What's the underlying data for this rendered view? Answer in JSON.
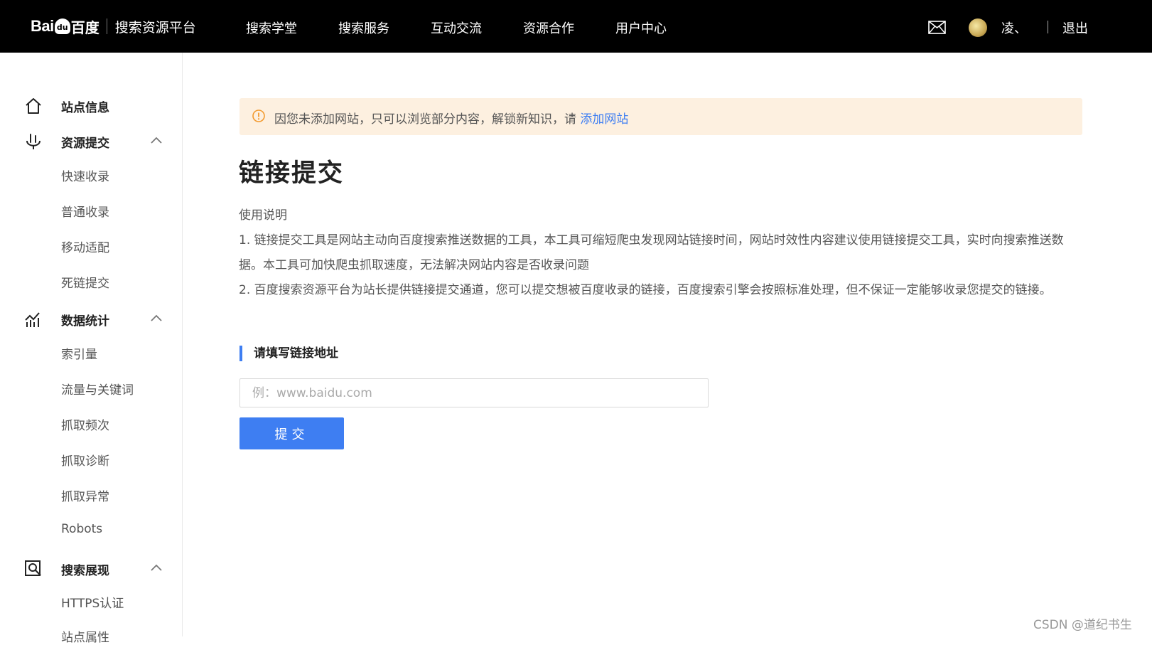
{
  "header": {
    "logo_brand": "Bai",
    "logo_du": "du",
    "logo_cn": "百度",
    "platform_name": "搜索资源平台",
    "nav": [
      "搜索学堂",
      "搜索服务",
      "互动交流",
      "资源合作",
      "用户中心"
    ],
    "username": "凌、",
    "logout_label": "退出"
  },
  "sidebar": {
    "groups": [
      {
        "label": "站点信息",
        "icon": "home-icon"
      },
      {
        "label": "资源提交",
        "icon": "submit-icon",
        "items": [
          "快速收录",
          "普通收录",
          "移动适配",
          "死链提交"
        ]
      },
      {
        "label": "数据统计",
        "icon": "chart-icon",
        "items": [
          "索引量",
          "流量与关键词",
          "抓取频次",
          "抓取诊断",
          "抓取异常",
          "Robots"
        ]
      },
      {
        "label": "搜索展现",
        "icon": "search-display-icon",
        "items": [
          "HTTPS认证",
          "站点属性"
        ]
      }
    ]
  },
  "notice": {
    "text": "因您未添加网站，只可以浏览部分内容，解锁新知识，请 ",
    "link": "添加网站",
    "color": "#fdf0e0"
  },
  "main": {
    "title": "链接提交",
    "desc_heading": "使用说明",
    "desc_line1": "1. 链接提交工具是网站主动向百度搜索推送数据的工具，本工具可缩短爬虫发现网站链接时间，网站时效性内容建议使用链接提交工具，实时向搜索推送数",
    "desc_line1b": "据。本工具可加快爬虫抓取速度，无法解决网站内容是否收录问题",
    "desc_line2": "2. 百度搜索资源平台为站长提供链接提交通道，您可以提交想被百度收录的链接，百度搜索引擎会按照标准处理，但不保证一定能够收录您提交的链接。",
    "section_title": "请填写链接地址",
    "input_value": "",
    "input_placeholder": "例：www.baidu.com",
    "submit_label": "提交"
  },
  "accent_color": "#3e7ef2",
  "watermark": "CSDN @道纪书生"
}
